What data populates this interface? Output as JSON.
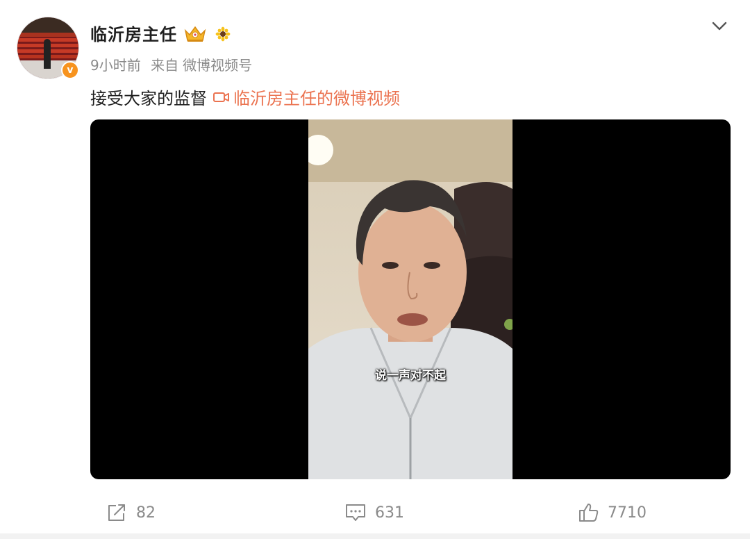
{
  "post": {
    "author": {
      "name": "临沂房主任",
      "avatar_icon": "avatar-theater-photo",
      "verified_icon": "verified-badge-icon",
      "verified_mark": "v",
      "badge_icons": [
        "crown-icon",
        "sunflower-icon"
      ]
    },
    "meta": {
      "time": "9小时前",
      "source_prefix": "来自",
      "source": "微博视频号"
    },
    "text": "接受大家的监督",
    "video_link": {
      "icon": "video-camera-icon",
      "label": "临沂房主任的微博视频"
    },
    "video": {
      "subtitle": "说一声对不起"
    },
    "actions": {
      "repost_count": "82",
      "comment_count": "631",
      "like_count": "7710"
    }
  },
  "colors": {
    "accent": "#eb7350",
    "muted_text": "#8a8a8a",
    "verified_badge": "#f7931e"
  }
}
